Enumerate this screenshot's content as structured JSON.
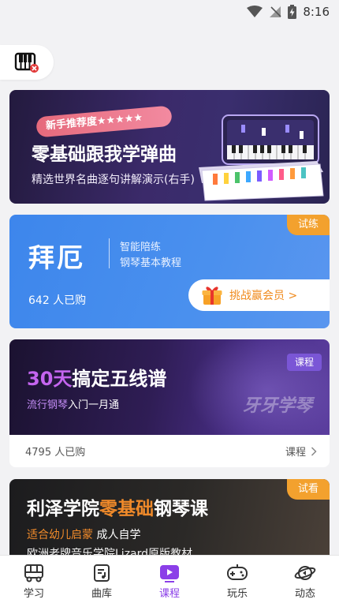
{
  "status_bar": {
    "time": "8:16"
  },
  "cards": [
    {
      "tag": "新手推荐度★★★★★",
      "title": "零基础跟我学弹曲",
      "subtitle": "精选世界名曲逐句讲解演示(右手)"
    },
    {
      "title": "拜厄",
      "desc_line1": "智能陪练",
      "desc_line2": "钢琴基本教程",
      "badge": "试练",
      "buyers": "642 人已购",
      "challenge_label": "挑战赢会员 >"
    },
    {
      "title_highlight": "30天",
      "title_rest": "搞定五线谱",
      "subtitle_highlight": "流行钢琴",
      "subtitle_rest": "入门一月通",
      "badge": "课程",
      "watermark": "牙牙学琴",
      "buyers": "4795 人已购",
      "link_label": "课程"
    },
    {
      "title_part1": "利泽学院",
      "title_part2": "零基础",
      "title_part3": "钢琴课",
      "badge": "试看",
      "line2_highlight": "适合幼儿启蒙",
      "line2_rest": " 成人自学",
      "line3": "欧洲老牌音乐学院Lizard原版教材"
    }
  ],
  "bottom_nav": {
    "items": [
      {
        "label": "学习",
        "icon": "school-bus-icon"
      },
      {
        "label": "曲库",
        "icon": "music-library-icon"
      },
      {
        "label": "课程",
        "icon": "video-course-icon",
        "active": true
      },
      {
        "label": "玩乐",
        "icon": "gamepad-icon"
      },
      {
        "label": "动态",
        "icon": "planet-icon"
      }
    ]
  },
  "colors": {
    "accent_purple": "#8b3fe8",
    "orange": "#f08a2a",
    "blue_card": "#4a90ee"
  }
}
